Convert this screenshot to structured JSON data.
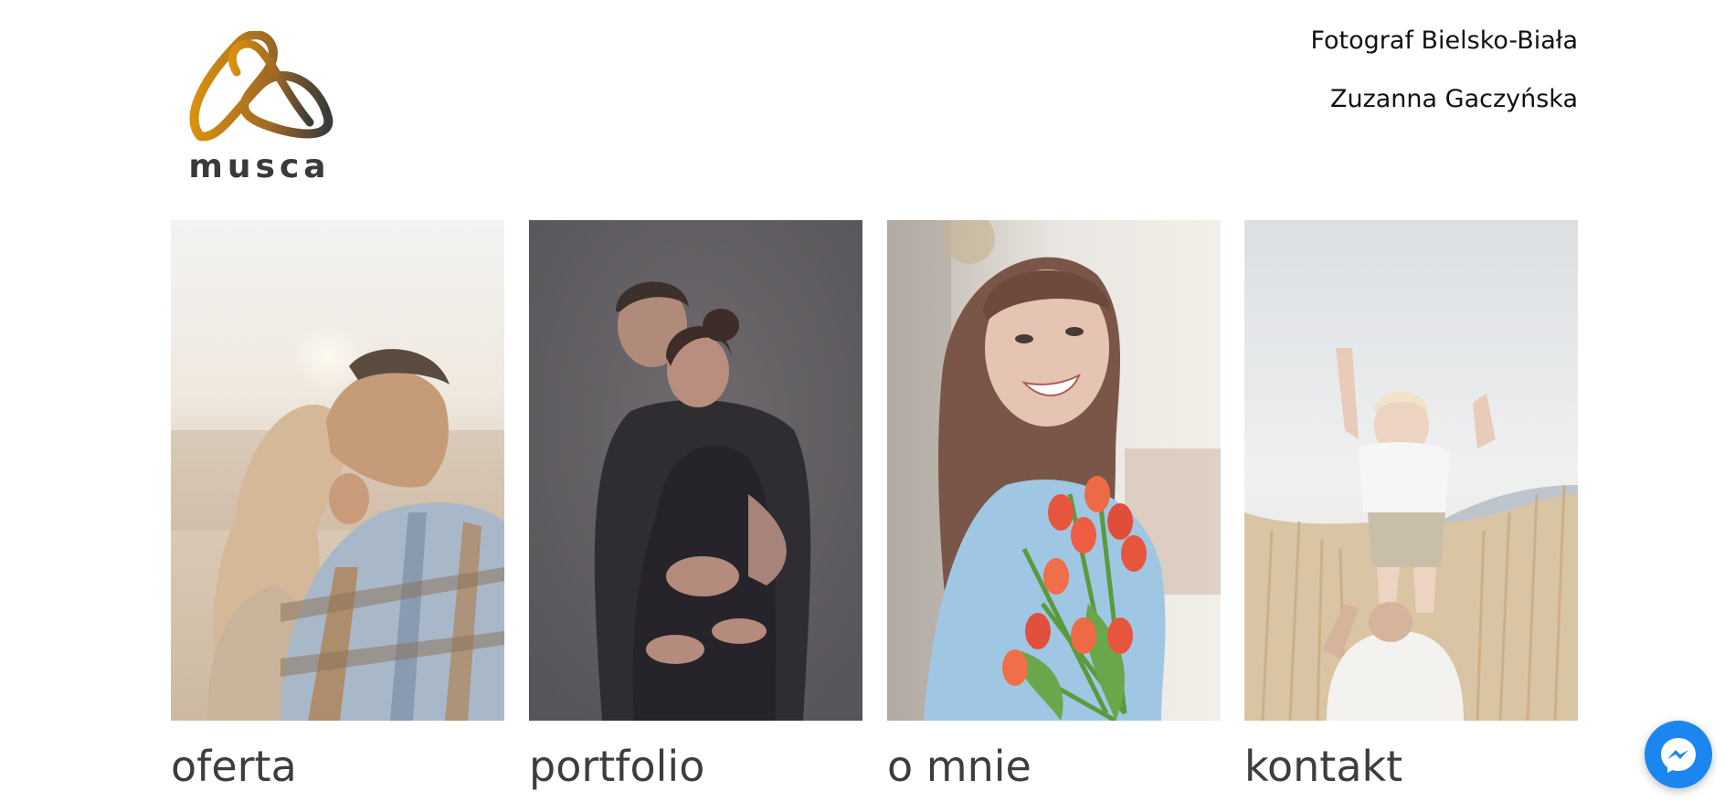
{
  "header": {
    "logo_text": "musca",
    "nav": [
      {
        "label": "Fotograf Bielsko-Biała"
      },
      {
        "label": "Zuzanna Gaczyńska"
      }
    ]
  },
  "tiles": [
    {
      "label": "oferta",
      "icon": "couple-kiss-photo"
    },
    {
      "label": "portfolio",
      "icon": "maternity-couple-photo"
    },
    {
      "label": "o mnie",
      "icon": "woman-with-tulips-photo"
    },
    {
      "label": "kontakt",
      "icon": "child-in-field-photo"
    }
  ],
  "messenger": {
    "icon": "messenger-icon",
    "color": "#1b86f0"
  },
  "colors": {
    "logo_gold": "#d8900e",
    "logo_dark": "#3a3a3a",
    "label_text": "#3d3d3d"
  }
}
